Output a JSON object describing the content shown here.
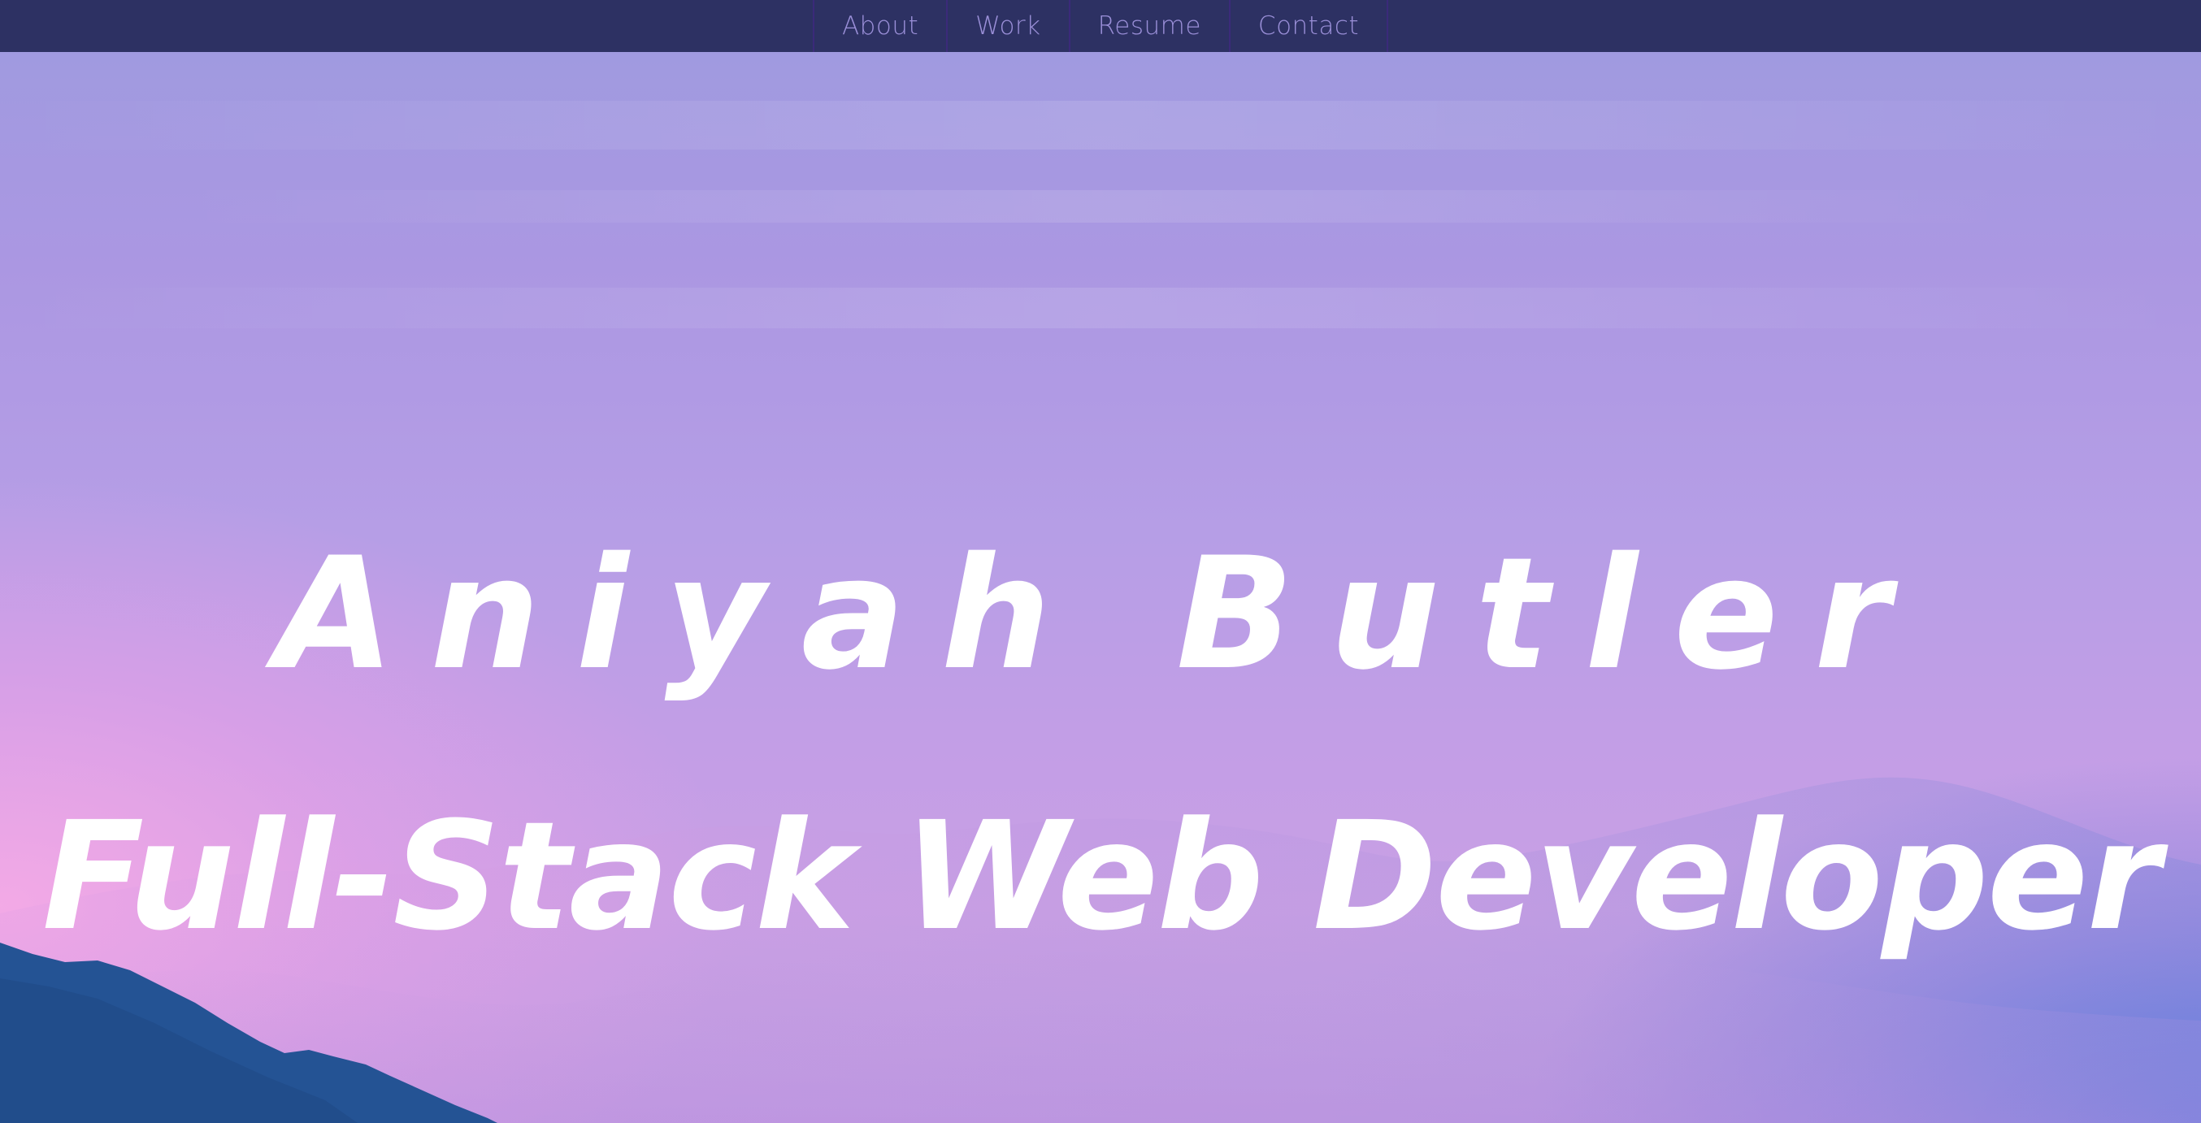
{
  "nav": {
    "items": [
      {
        "label": "About"
      },
      {
        "label": "Work"
      },
      {
        "label": "Resume"
      },
      {
        "label": "Contact"
      }
    ]
  },
  "hero": {
    "name": "Aniyah Butler",
    "title": "Full-Stack Web Developer"
  },
  "colors": {
    "navbar_bg": "#2d3163",
    "nav_text": "#9a8fd8",
    "nav_divider": "#3b2a7a",
    "hero_text": "#ffffff",
    "mountain": "#245394"
  }
}
